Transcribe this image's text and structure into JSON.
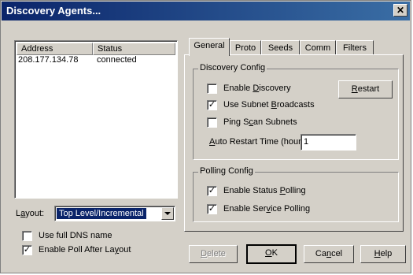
{
  "window": {
    "title": "Discovery Agents..."
  },
  "agents_list": {
    "columns": [
      "Address",
      "Status"
    ],
    "rows": [
      {
        "address": "208.177.134.78",
        "status": "connected"
      }
    ]
  },
  "layout": {
    "label_pre": "L",
    "label_u": "a",
    "label_post": "yout:",
    "selected": "Top Level/Incremental"
  },
  "options": {
    "full_dns": {
      "label": "Use full DNS name",
      "checked": false
    },
    "poll_after": {
      "pre": "Enable Poll After La",
      "u": "y",
      "post": "out",
      "checked": true
    }
  },
  "tabs": [
    "General",
    "Proto",
    "Seeds",
    "Comm",
    "Filters"
  ],
  "discovery_config": {
    "title": "Discovery Config",
    "enable_discovery": {
      "pre": "Enable ",
      "u": "D",
      "post": "iscovery",
      "checked": false
    },
    "subnet_broadcasts": {
      "pre": "Use Subnet ",
      "u": "B",
      "post": "roadcasts",
      "checked": true
    },
    "ping_scan": {
      "pre": "Ping S",
      "u": "c",
      "post": "an Subnets",
      "checked": false
    },
    "restart_button": {
      "u": "R",
      "post": "estart"
    },
    "auto_restart": {
      "u": "A",
      "post": "uto Restart Time (hours):",
      "value": "1"
    }
  },
  "polling_config": {
    "title": "Polling Config",
    "status_polling": {
      "pre": "Enable Status ",
      "u": "P",
      "post": "olling",
      "checked": true
    },
    "service_polling": {
      "pre": "Enable Ser",
      "u": "v",
      "post": "ice Polling",
      "checked": true
    }
  },
  "buttons": {
    "delete": {
      "u": "D",
      "post": "elete"
    },
    "ok": {
      "u": "O",
      "post": "K"
    },
    "cancel": {
      "pre": "Ca",
      "u": "n",
      "post": "cel"
    },
    "help": {
      "u": "H",
      "post": "elp"
    }
  }
}
